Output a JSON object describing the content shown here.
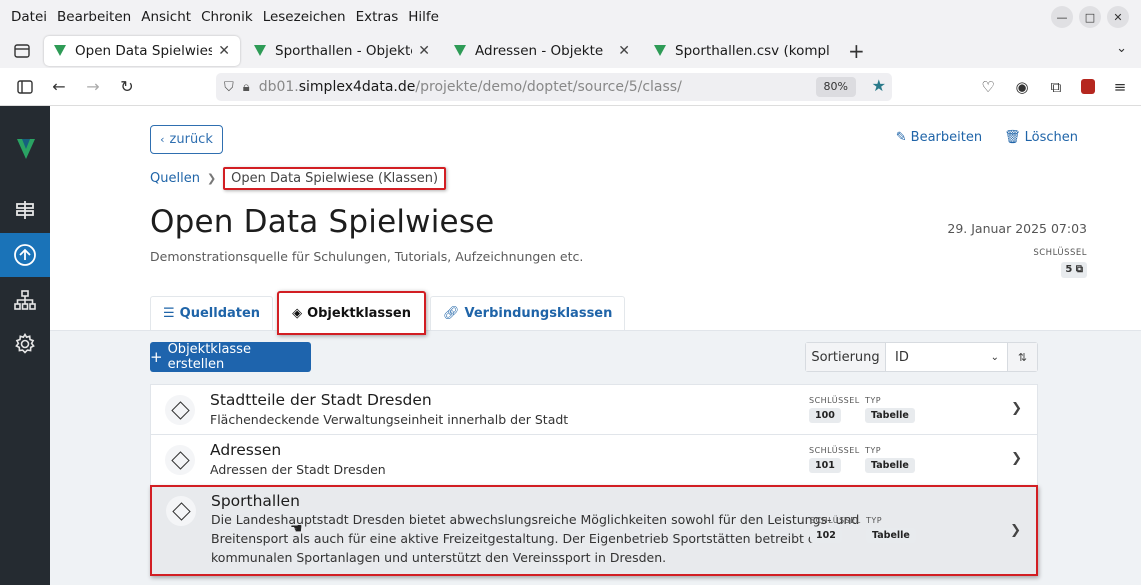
{
  "menubar": {
    "items": [
      "Datei",
      "Bearbeiten",
      "Ansicht",
      "Chronik",
      "Lesezeichen",
      "Extras",
      "Hilfe"
    ]
  },
  "browser_tabs": [
    {
      "title": "Open Data Spielwiese - O",
      "active": true
    },
    {
      "title": "Sporthallen - Objekte",
      "active": false
    },
    {
      "title": "Adressen - Objekte",
      "active": false
    },
    {
      "title": "Sporthallen.csv (komplett",
      "active": false
    }
  ],
  "urlbar": {
    "prefix": "db01.",
    "domain": "simplex4data.de",
    "path": "/projekte/demo/doptet/source/5/class/",
    "zoom": "80%"
  },
  "page": {
    "back_label": "zurück",
    "edit_label": "Bearbeiten",
    "delete_label": "Löschen",
    "breadcrumb_root": "Quellen",
    "breadcrumb_current": "Open Data Spielwiese (Klassen)",
    "title": "Open Data Spielwiese",
    "subtitle": "Demonstrationsquelle für Schulungen, Tutorials, Aufzeichnungen etc.",
    "date": "29. Januar 2025 07:03",
    "key_label": "SCHLÜSSEL",
    "key_value": "5",
    "tabs": [
      {
        "label": "Quelldaten",
        "icon": "database-icon"
      },
      {
        "label": "Objektklassen",
        "icon": "diamond-icon"
      },
      {
        "label": "Verbindungsklassen",
        "icon": "link-icon"
      }
    ],
    "create_label": "Objektklasse erstellen",
    "sort_label": "Sortierung",
    "sort_value": "ID"
  },
  "list": {
    "key_header": "SCHLÜSSEL",
    "type_header": "TYP",
    "items": [
      {
        "name": "Stadtteile der Stadt Dresden",
        "desc": "Flächendeckende Verwaltungseinheit innerhalb der Stadt",
        "key": "100",
        "type": "Tabelle"
      },
      {
        "name": "Adressen",
        "desc": "Adressen der Stadt Dresden",
        "key": "101",
        "type": "Tabelle"
      },
      {
        "name": "Sporthallen",
        "desc_lines": [
          "Die Landeshauptstadt Dresden bietet abwechslungsreiche Möglichkeiten sowohl für den Leistungs- und",
          "Breitensport als auch für eine aktive Freizeitgestaltung. Der Eigenbetrieb Sportstätten betreibt die",
          "kommunalen Sportanlagen und unterstützt den Vereinssport in Dresden."
        ],
        "key": "102",
        "type": "Tabelle"
      }
    ]
  }
}
